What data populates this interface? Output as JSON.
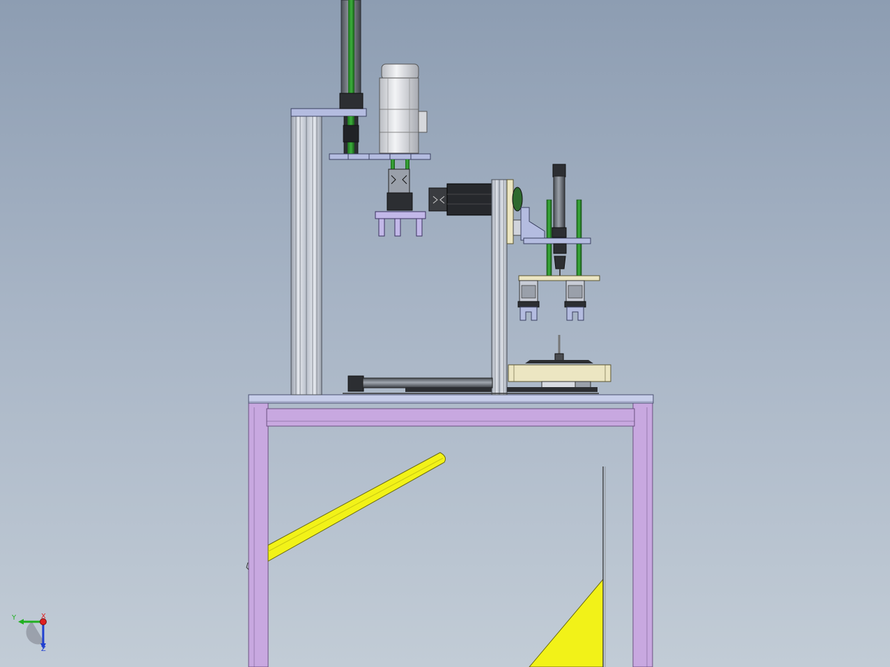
{
  "axis_triad": {
    "x_label": "X",
    "y_label": "Y",
    "z_label": "Z",
    "x_color": "#e02020",
    "y_color": "#20b020",
    "z_color": "#2040d0"
  },
  "colors": {
    "frame": "#c8a8e0",
    "frame_edge": "#6a4f80",
    "profile": "#c8cdd8",
    "plate": "#b4bce0",
    "rod": "#2a8a2a",
    "motor_dark": "#2a2a2a",
    "motor_silver": "#e2e4e8",
    "beige": "#ece6c2",
    "chute_yellow": "#f2f218"
  }
}
